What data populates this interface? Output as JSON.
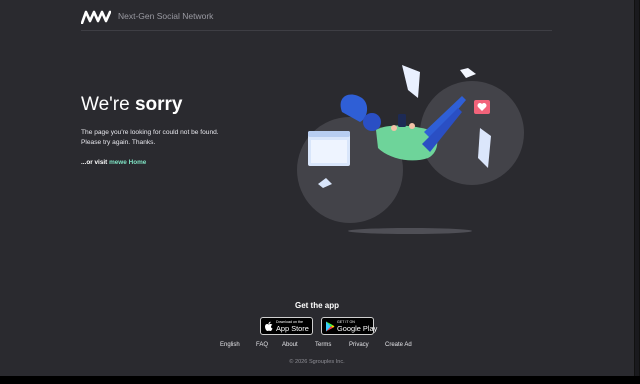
{
  "header": {
    "logo_icon": "mewe-logo-icon",
    "tagline": "Next-Gen Social Network"
  },
  "hero": {
    "title_light": "We're ",
    "title_bold": "sorry",
    "line1": "The page you're looking for could not be found.",
    "line2": "Please try again. Thanks.",
    "visit_prefix": "...or visit ",
    "visit_link": "mewe Home"
  },
  "app": {
    "heading": "Get the app",
    "app_store_pre": "Download on the",
    "app_store_main": "App Store",
    "google_play_pre": "GET IT ON",
    "google_play_main": "Google Play"
  },
  "footer": {
    "links": [
      "English",
      "FAQ",
      "About",
      "Terms",
      "Privacy",
      "Create Ad"
    ],
    "copyright": "© 2026 Sgrouples Inc."
  },
  "colors": {
    "background": "#2a2a2f",
    "accent_link": "#7fe3c4",
    "circle": "#434349"
  }
}
